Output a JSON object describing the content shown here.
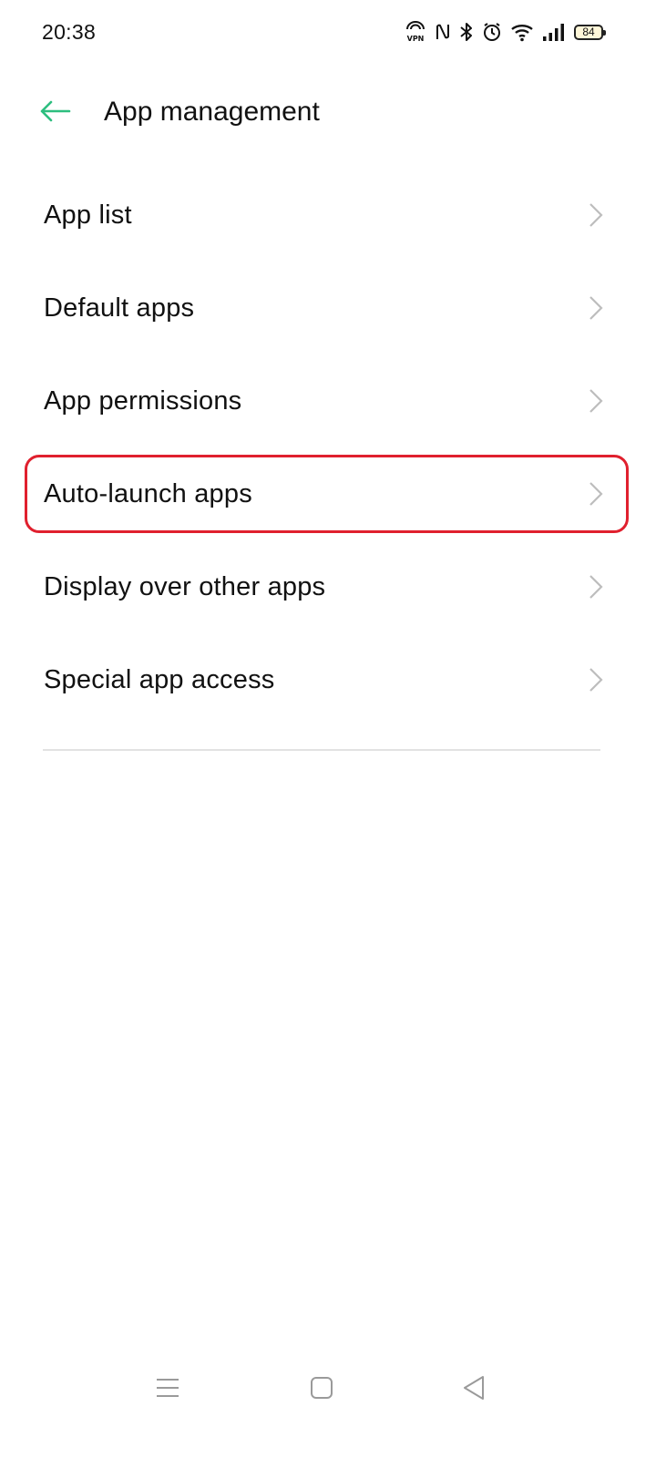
{
  "status_bar": {
    "time": "20:38",
    "icons": [
      "vpn-icon",
      "nfc-icon",
      "bluetooth-icon",
      "alarm-icon",
      "wifi-icon",
      "signal-icon"
    ],
    "battery_level": "84"
  },
  "header": {
    "title": "App management",
    "back_icon": "arrow-left-icon",
    "accent_color": "#2dbe7f"
  },
  "menu": {
    "items": [
      {
        "label": "App list"
      },
      {
        "label": "Default apps"
      },
      {
        "label": "App permissions"
      },
      {
        "label": "Auto-launch apps",
        "highlighted": true
      },
      {
        "label": "Display over other apps"
      },
      {
        "label": "Special app access"
      }
    ],
    "chevron_icon": "chevron-right-icon",
    "highlight_color": "#e0202e"
  },
  "nav_bar": {
    "buttons": [
      "menu-icon",
      "home-icon",
      "back-triangle-icon"
    ]
  }
}
